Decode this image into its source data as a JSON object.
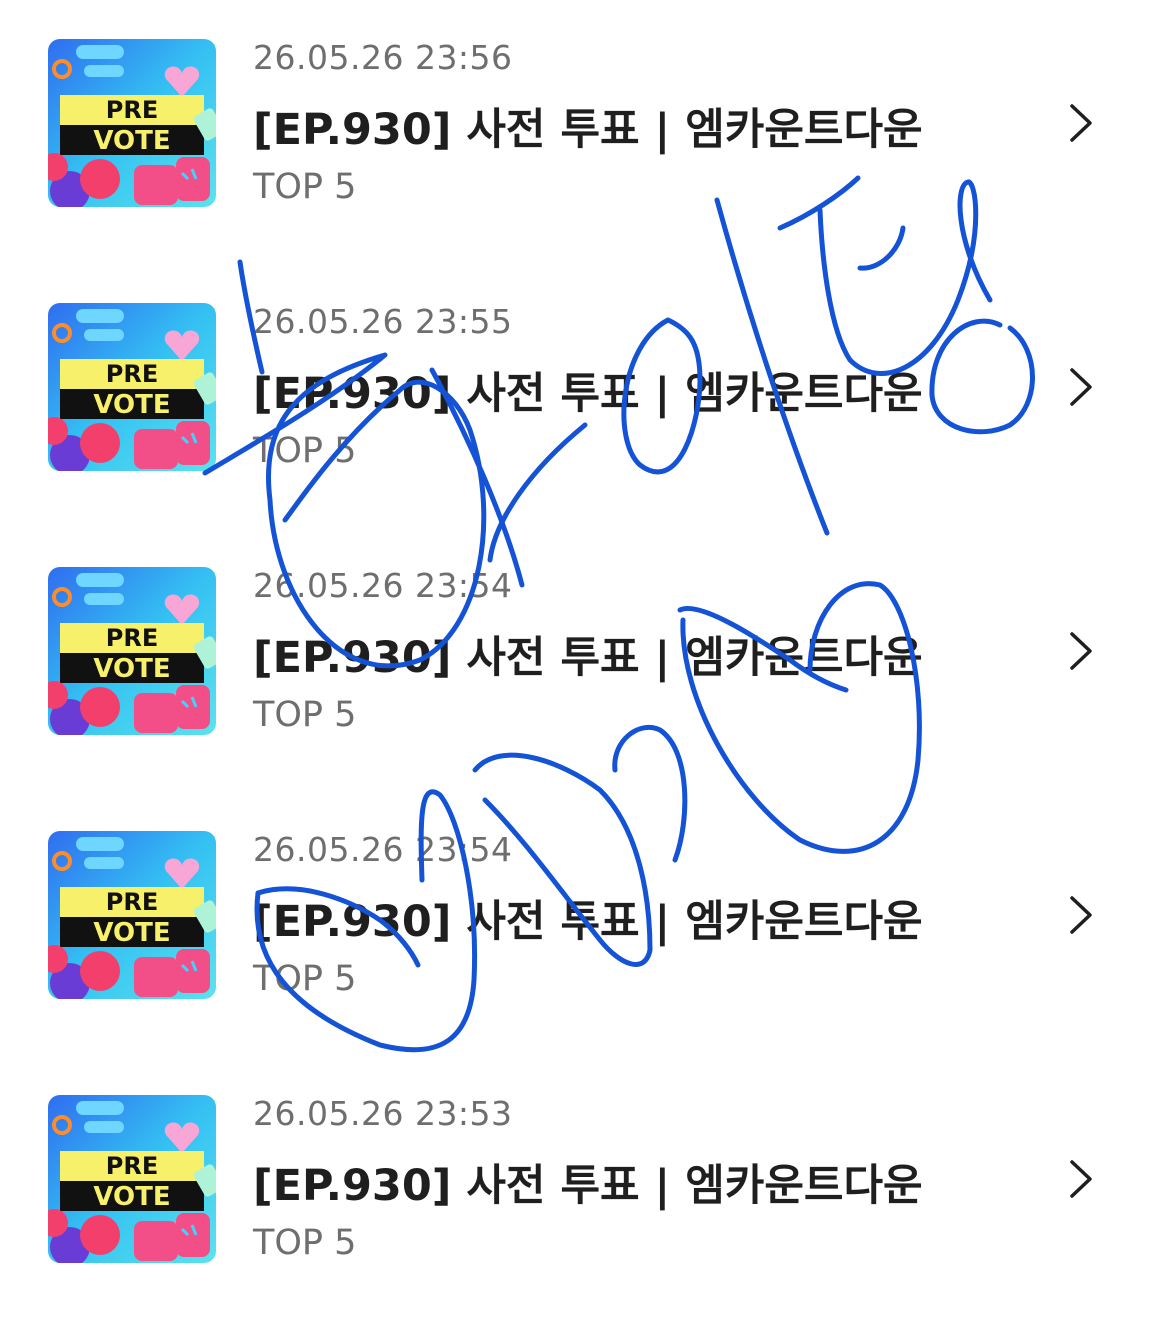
{
  "items": [
    {
      "date": "26.05.26 23:56",
      "title": "[EP.930] 사전 투표 | 엠카운트다운",
      "subtitle": "TOP 5",
      "thumb_line1": "PRE",
      "thumb_line2": "VOTE"
    },
    {
      "date": "26.05.26 23:55",
      "title": "[EP.930] 사전 투표 | 엠카운트다운",
      "subtitle": "TOP 5",
      "thumb_line1": "PRE",
      "thumb_line2": "VOTE"
    },
    {
      "date": "26.05.26 23:54",
      "title": "[EP.930] 사전 투표 | 엠카운트다운",
      "subtitle": "TOP 5",
      "thumb_line1": "PRE",
      "thumb_line2": "VOTE"
    },
    {
      "date": "26.05.26 23:54",
      "title": "[EP.930] 사전 투표 | 엠카운트다운",
      "subtitle": "TOP 5",
      "thumb_line1": "PRE",
      "thumb_line2": "VOTE"
    },
    {
      "date": "26.05.26 23:53",
      "title": "[EP.930] 사전 투표 | 엠카운트다운",
      "subtitle": "TOP 5",
      "thumb_line1": "PRE",
      "thumb_line2": "VOTE"
    }
  ],
  "icons": {
    "chevron": "chevron-right-icon",
    "thumbnail": "pre-vote-thumbnail"
  },
  "colors": {
    "title": "#1f1f1f",
    "meta": "#6e6e6e",
    "scribble": "#1453d6",
    "thumb_bg": "#36c3f0",
    "thumb_band": "#f7f06a"
  }
}
